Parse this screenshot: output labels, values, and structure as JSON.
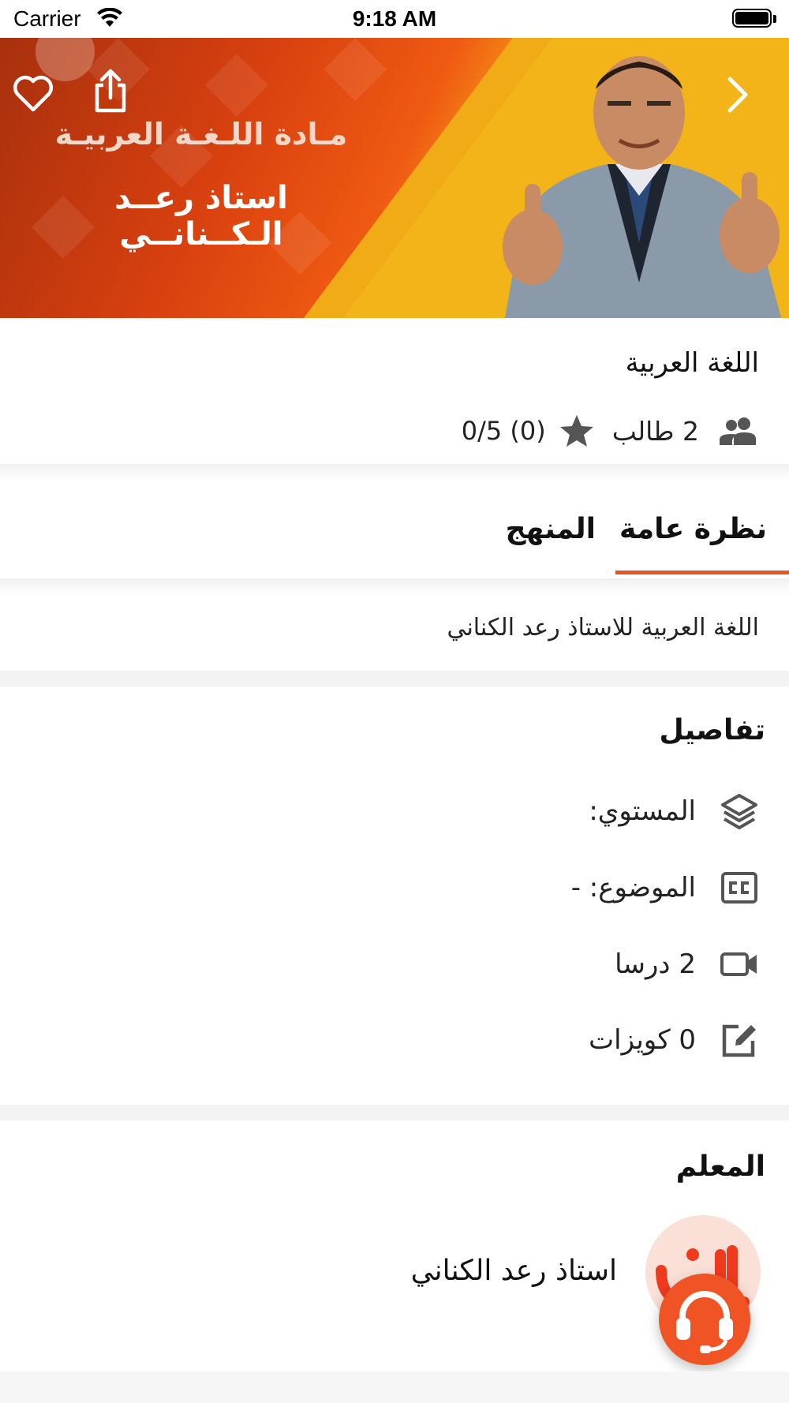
{
  "status_bar": {
    "carrier": "Carrier",
    "time": "9:18 AM"
  },
  "hero": {
    "title": "مـادة اللـغـة العربيـة",
    "subtitle": "استاذ رعــد الـكــنانــي"
  },
  "course": {
    "title": "اللغة العربية",
    "students": "2 طالب",
    "rating": "0/5 (0)"
  },
  "tabs": [
    {
      "label": "نظرة عامة",
      "active": true
    },
    {
      "label": "المنهج",
      "active": false
    }
  ],
  "description": "اللغة العربية للاستاذ رعد الكناني",
  "details": {
    "title": "تفاصيل",
    "level": "المستوي:",
    "subject": "الموضوع: -",
    "lessons": "2 درسا",
    "quizzes": "0 كويزات"
  },
  "teacher": {
    "title": "المعلم",
    "name": "استاذ رعد الكناني"
  },
  "colors": {
    "accent": "#e8542a",
    "fab": "#f05425"
  },
  "icons": [
    "heart-icon",
    "share-icon",
    "chevron-right-icon",
    "people-icon",
    "star-icon",
    "layers-icon",
    "cc-icon",
    "video-icon",
    "edit-icon",
    "headset-icon"
  ]
}
